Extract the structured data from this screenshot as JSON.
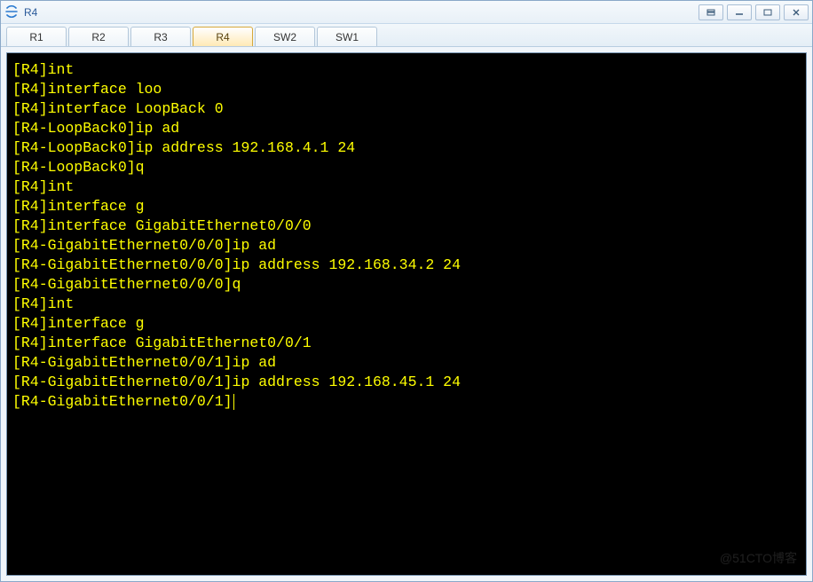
{
  "window": {
    "title": "R4"
  },
  "tabs": [
    {
      "label": "R1",
      "active": false
    },
    {
      "label": "R2",
      "active": false
    },
    {
      "label": "R3",
      "active": false
    },
    {
      "label": "R4",
      "active": true
    },
    {
      "label": "SW2",
      "active": false
    },
    {
      "label": "SW1",
      "active": false
    }
  ],
  "terminal": {
    "lines": [
      "[R4]int",
      "[R4]interface loo",
      "[R4]interface LoopBack 0",
      "[R4-LoopBack0]ip ad",
      "[R4-LoopBack0]ip address 192.168.4.1 24",
      "[R4-LoopBack0]q",
      "[R4]int",
      "[R4]interface g",
      "[R4]interface GigabitEthernet0/0/0",
      "[R4-GigabitEthernet0/0/0]ip ad",
      "[R4-GigabitEthernet0/0/0]ip address 192.168.34.2 24",
      "[R4-GigabitEthernet0/0/0]q",
      "[R4]int",
      "[R4]interface g",
      "[R4]interface GigabitEthernet0/0/1",
      "[R4-GigabitEthernet0/0/1]ip ad",
      "[R4-GigabitEthernet0/0/1]ip address 192.168.45.1 24",
      "[R4-GigabitEthernet0/0/1]"
    ]
  },
  "watermark": "@51CTO博客"
}
